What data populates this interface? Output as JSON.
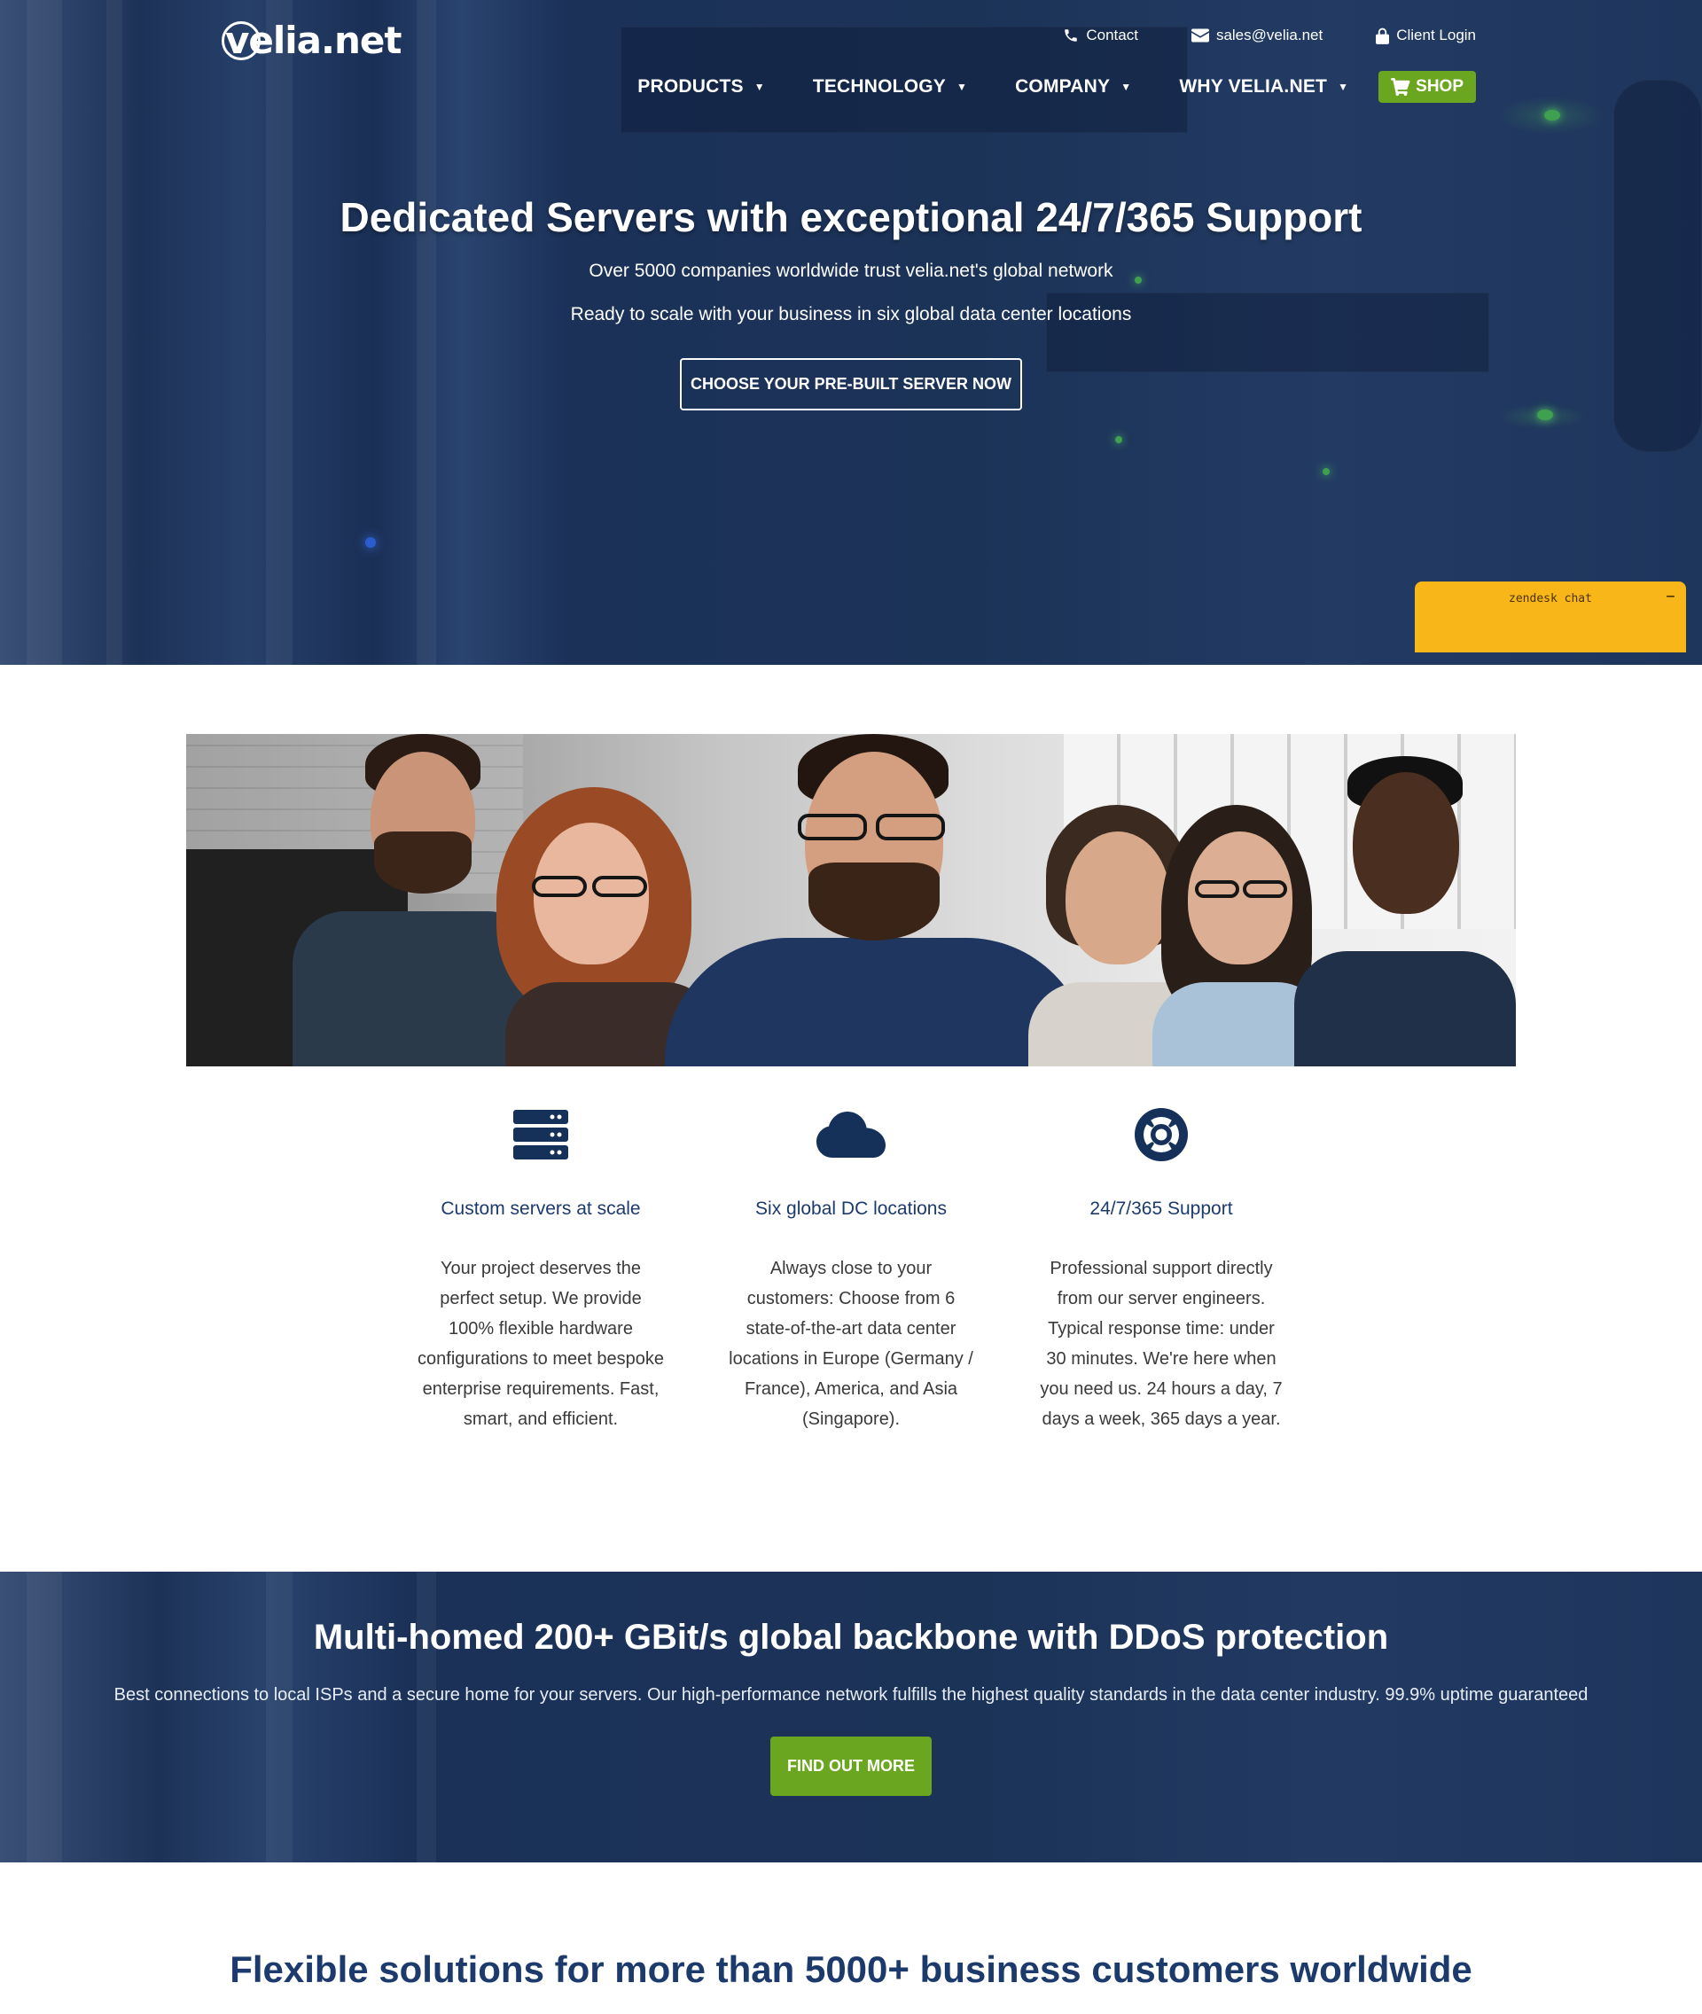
{
  "header": {
    "logo_text": "velia.net",
    "topbar": {
      "contact": "Contact",
      "email": "sales@velia.net",
      "login": "Client Login"
    },
    "nav": [
      {
        "label": "PRODUCTS"
      },
      {
        "label": "TECHNOLOGY"
      },
      {
        "label": "COMPANY"
      },
      {
        "label": "WHY VELIA.NET"
      }
    ],
    "shop_label": "SHOP"
  },
  "hero": {
    "title": "Dedicated Servers with exceptional 24/7/365 Support",
    "subtitle1": "Over 5000 companies worldwide trust velia.net's global network",
    "subtitle2": "Ready to scale with your business in six global data center locations",
    "cta": "CHOOSE YOUR PRE-BUILT SERVER NOW"
  },
  "chat_widget": {
    "label": "zendesk chat",
    "minimize": "–"
  },
  "features": [
    {
      "icon": "server-icon",
      "title": "Custom servers at scale",
      "text": "Your project deserves the perfect setup. We provide 100% flexible hardware configurations to meet bespoke enterprise requirements. Fast, smart, and efficient."
    },
    {
      "icon": "cloud-icon",
      "title": "Six global DC locations",
      "text": "Always close to your customers: Choose from 6 state-of-the-art data center locations in Europe (Germany / France), America, and Asia (Singapore)."
    },
    {
      "icon": "lifebuoy-icon",
      "title": "24/7/365 Support",
      "text": "Professional support directly from our server engineers. Typical response time: under 30 minutes. We're here when you need us. 24 hours a day, 7 days a week, 365 days a year."
    }
  ],
  "backbone": {
    "title": "Multi-homed 200+ GBit/s global backbone with DDoS protection",
    "text": "Best connections to local ISPs and a secure home for your servers. Our high-performance network fulfills the highest quality standards in the data center industry. 99.9% uptime guaranteed",
    "cta": "FIND OUT MORE"
  },
  "solutions": {
    "title": "Flexible solutions for more than 5000+ business customers worldwide"
  },
  "colors": {
    "navy": "#1b3158",
    "green": "#6aa620",
    "zendesk": "#f8b619",
    "heading": "#1c3a6b"
  }
}
